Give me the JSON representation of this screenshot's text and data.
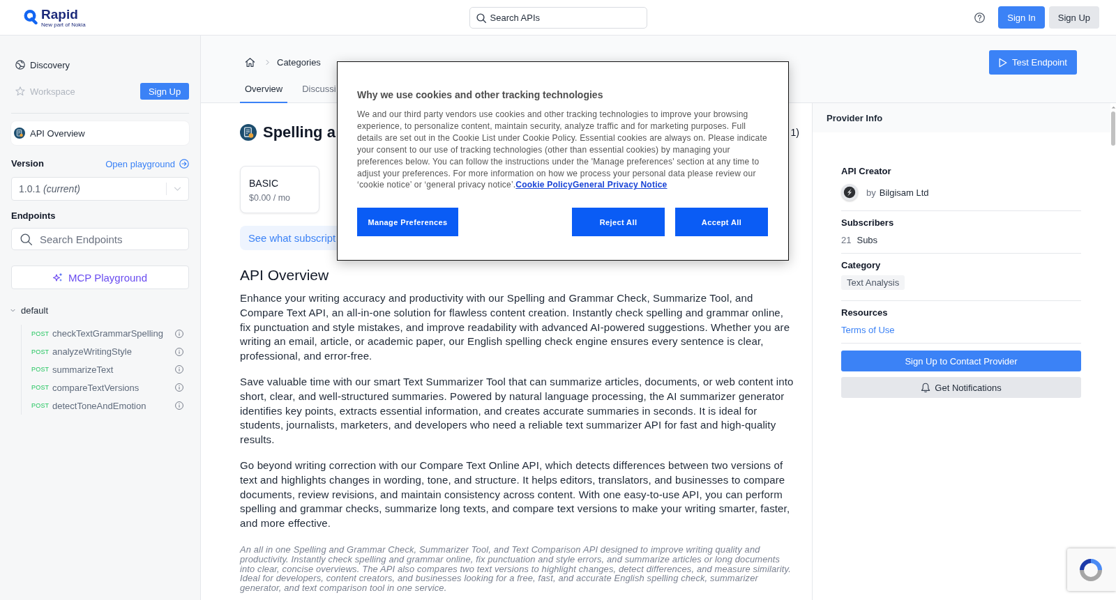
{
  "header": {
    "logo": {
      "name": "Rapid",
      "tagline": "New part of Nokia"
    },
    "search": {
      "placeholder": "Search APIs"
    },
    "buttons": [
      {
        "label": "Sign In",
        "kind": "primary"
      },
      {
        "label": "Sign Up",
        "kind": "secondary"
      }
    ]
  },
  "sidebar": {
    "nav": [
      {
        "label": "Discovery",
        "disabled": false
      },
      {
        "label": "Workspace",
        "disabled": true,
        "button": "Sign Up"
      }
    ],
    "api_overview": {
      "label": "API Overview",
      "selected": true
    },
    "version": {
      "label": "Version",
      "link": "Open playground",
      "value": "1.0.1 *(current)*"
    },
    "endpoints": {
      "label": "Endpoints",
      "search": {
        "placeholder": "Search Endpoints"
      },
      "mcp_button": "MCP Playground",
      "groups": [
        {
          "name": "default",
          "expanded": true,
          "children": [
            {
              "method": "POST",
              "name": "checkTextGrammarSpelling"
            },
            {
              "method": "POST",
              "name": "analyzeWritingStyle"
            },
            {
              "method": "POST",
              "name": "summarizeText"
            },
            {
              "method": "POST",
              "name": "compareTextVersions"
            },
            {
              "method": "POST",
              "name": "detectToneAndEmotion"
            }
          ]
        }
      ]
    }
  },
  "main": {
    "breadcrumb": [
      "Categories"
    ],
    "test_button": "Test Endpoint",
    "tabs": [
      {
        "label": "Overview",
        "selected": true
      },
      {
        "label": "Discussi",
        "selected": false
      }
    ],
    "title": "Spelling a",
    "title_fragment": "1)",
    "plans": [
      {
        "name": "BASIC",
        "price": "$0.00 / mo"
      }
    ],
    "banner": "See what subscript",
    "overview": {
      "heading": "API Overview",
      "paragraphs": [
        "Enhance your writing accuracy and productivity with our Spelling and Grammar Check, Summarize Tool, and Compare Text API, an all-in-one solution for flawless content creation. Instantly check spelling and grammar online, fix punctuation and style mistakes, and improve readability with advanced AI-powered suggestions. Whether you are writing an email, article, or academic paper, our English spelling check engine ensures every sentence is clear, professional, and error-free.",
        "Save valuable time with our smart Text Summarizer Tool that can summarize articles, documents, or web content into short, clear, and well-structured summaries. Powered by natural language processing, the AI summarizer generator identifies key points, extracts essential information, and creates accurate summaries in seconds. It is ideal for students, journalists, marketers, and developers who need a reliable text summarizer API for fast and high-quality results.",
        "Go beyond writing correction with our Compare Text Online API, which detects differences between two versions of text and highlights changes in wording, tone, and structure. It helps editors, translators, and businesses to compare documents, review revisions, and maintain consistency across content. With one easy-to-use API, you can perform spelling and grammar checks, summarize long texts, and compare text versions to make your writing smarter, faster, and more effective."
      ],
      "summary": "An all in one Spelling and Grammar Check, Summarizer Tool, and Text Comparison API designed to improve writing quality and productivity. Instantly check spelling and grammar online, fix punctuation and style errors, and summarize articles or long documents into clear, concise overviews. The API also compares two text versions to highlight changes, detect differences, and measure similarity. Ideal for developers, content creators, and businesses looking for a free, fast, and accurate English spelling check, summarizer generator, and text comparison tool in one service."
    }
  },
  "provider_info": {
    "title": "Provider Info",
    "sections": [
      {
        "kind": "creator",
        "heading": "API Creator",
        "prefix": "by",
        "value": "Bilgisam Ltd"
      },
      {
        "kind": "count",
        "heading": "Subscribers",
        "count": "21",
        "unit": "Subs"
      },
      {
        "kind": "tag",
        "heading": "Category",
        "value": "Text Analysis"
      },
      {
        "kind": "link",
        "heading": "Resources",
        "value": "Terms of Use"
      }
    ],
    "buttons": [
      {
        "label": "Sign Up to Contact Provider",
        "kind": "primary"
      },
      {
        "label": "Get Notifications",
        "kind": "secondary"
      }
    ]
  },
  "cookie_dialog": {
    "title": "Why we use cookies and other tracking technologies",
    "body": "We and our third party vendors use cookies and other tracking technologies to improve your browsing experience, to personalize content, maintain security, analyze traffic and for marketing purposes. Full details are set out in the Cookie List under Cookie Policy. Essential cookies are always on. Please indicate your consent to our use of tracking technologies (other than essential cookies) by managing your preferences below. You can follow the instructions under the 'Manage preferences' section at any time to adjust your preferences. For more information on how we process your personal data please review our ‘cookie notice’ or ‘general privacy notice’.",
    "links": [
      "Cookie Policy",
      "General Privacy Notice"
    ],
    "buttons": [
      "Manage Preferences",
      "Reject All",
      "Accept All"
    ]
  }
}
